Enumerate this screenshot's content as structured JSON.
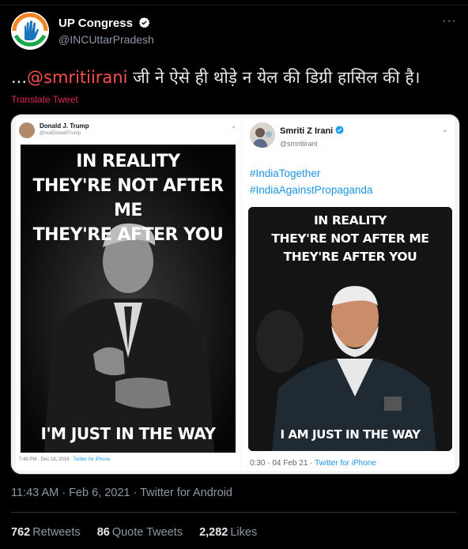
{
  "tweet": {
    "author_name": "UP Congress",
    "author_handle": "@INCUttarPradesh",
    "more_icon": "more-horizontal-icon",
    "text_prefix": "...",
    "mention": "@smritiirani",
    "text_rest": " जी ने ऐसे ही थोड़े न येल की डिग्री हासिल की है।",
    "translate_label": "Translate Tweet",
    "timestamp": "11:43 AM · Feb 6, 2021 · Twitter for Android",
    "stats": {
      "retweets_count": "762",
      "retweets_label": "Retweets",
      "quotes_count": "86",
      "quotes_label": "Quote Tweets",
      "likes_count": "2,282",
      "likes_label": "Likes"
    }
  },
  "media": {
    "left": {
      "name": "Donald J. Trump",
      "handle": "@realDonaldTrump",
      "meme_top": [
        "IN REALITY",
        "THEY'RE NOT AFTER ME",
        "THEY'RE AFTER YOU"
      ],
      "meme_bottom": "I'M JUST IN THE WAY",
      "footer_time": "7:49 PM · Dec 18, 2019 · ",
      "footer_app": "Twitter for iPhone"
    },
    "right": {
      "name": "Smriti Z Irani",
      "handle": "@smritiirani",
      "hashtag1": "#IndiaTogether",
      "hashtag2": "#IndiaAgainstPropaganda",
      "meme_top": [
        "IN REALITY",
        "THEY'RE  NOT AFTER ME",
        "THEY'RE AFTER YOU"
      ],
      "meme_bottom": "I AM JUST IN THE WAY",
      "footer_time": "0:30 · 04 Feb 21 · ",
      "footer_app": "Twitter for iPhone"
    }
  },
  "colors": {
    "background": "#000000",
    "mention": "#ff4d4d",
    "link": "#1b95e0",
    "verified": "#1da1f2"
  }
}
